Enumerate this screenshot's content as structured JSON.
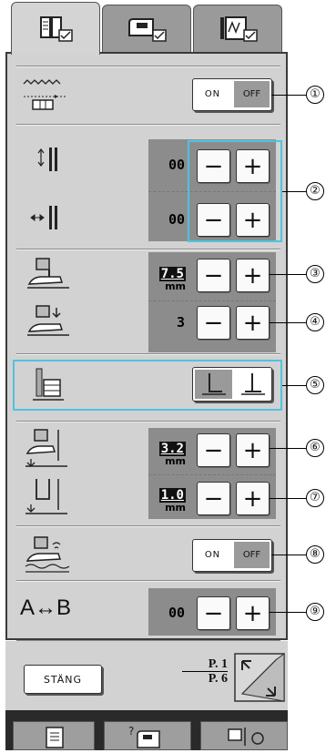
{
  "tabs": [
    {
      "name": "utility",
      "active": true
    },
    {
      "name": "machine",
      "active": false
    },
    {
      "name": "embroidery",
      "active": false
    }
  ],
  "rows": {
    "free_motion": {
      "on_label": "ON",
      "off_label": "OFF",
      "callout": "①"
    },
    "width_control": {
      "vertical_value": "00",
      "horizontal_value": "00",
      "callout": "②"
    },
    "pivot_height": {
      "value": "7.5",
      "unit": "mm",
      "callout": "③"
    },
    "presser_pressure": {
      "value": "3",
      "callout": "④"
    },
    "foot_position": {
      "callout": "⑤"
    },
    "foot_height": {
      "value": "3.2",
      "unit": "mm",
      "callout": "⑥"
    },
    "needle_height": {
      "value": "1.0",
      "unit": "mm",
      "callout": "⑦"
    },
    "auto_fabric": {
      "on_label": "ON",
      "off_label": "OFF",
      "callout": "⑧"
    },
    "ab_stitch": {
      "label": "A↔B",
      "value": "00",
      "callout": "⑨"
    }
  },
  "minus": "−",
  "plus": "+",
  "close_label": "STÄNG",
  "page": {
    "current": "P. 1",
    "total": "P. 6"
  }
}
